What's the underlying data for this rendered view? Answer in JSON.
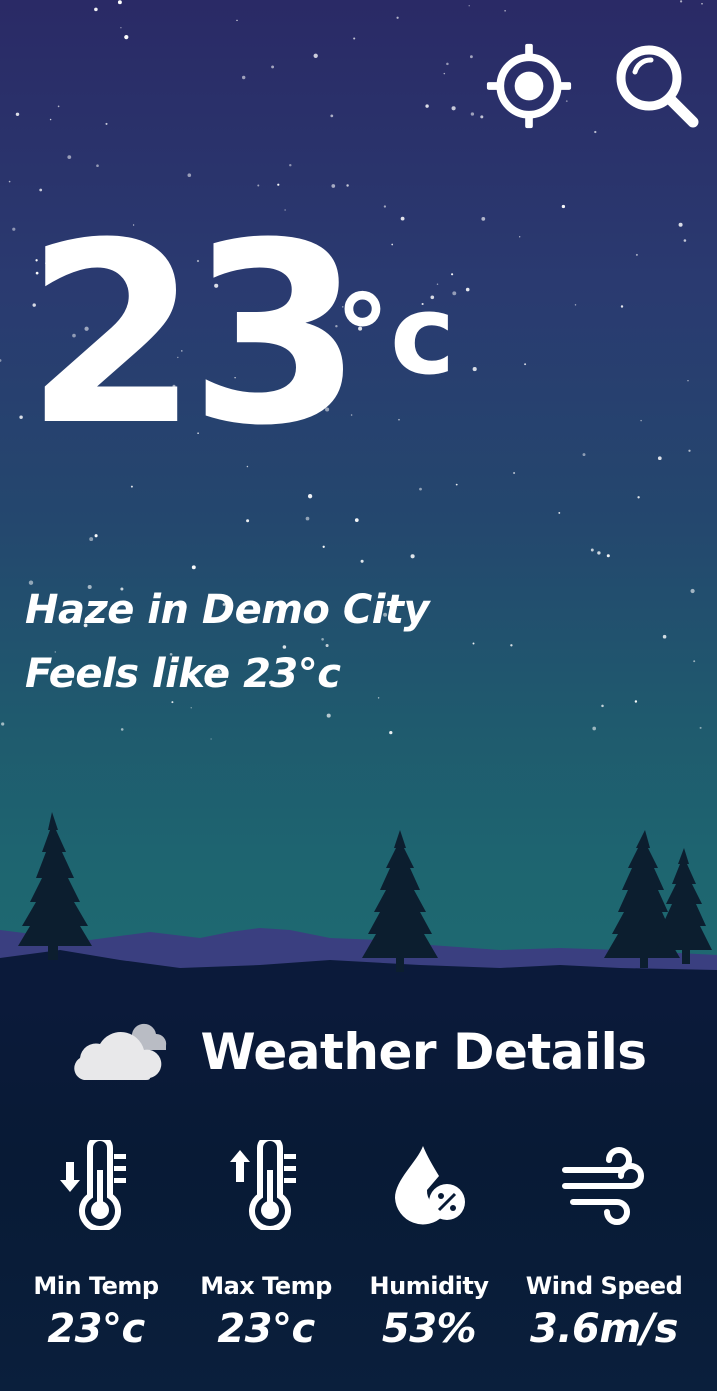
{
  "header": {
    "location_icon": "crosshair-location-icon",
    "search_icon": "search-icon"
  },
  "current": {
    "temperature": "23",
    "unit": "°c",
    "description": "Haze in Demo City",
    "feels_like": "Feels like 23°c"
  },
  "details": {
    "title": "Weather Details",
    "title_icon": "cloud-icon",
    "items": [
      {
        "label": "Min Temp",
        "value": "23°c",
        "icon": "thermometer-down-icon"
      },
      {
        "label": "Max Temp",
        "value": "23°c",
        "icon": "thermometer-up-icon"
      },
      {
        "label": "Humidity",
        "value": "53%",
        "icon": "humidity-drop-icon"
      },
      {
        "label": "Wind Speed",
        "value": "3.6m/s",
        "icon": "wind-icon"
      }
    ]
  },
  "colors": {
    "sky_top": "#2a2a66",
    "sky_bottom": "#1f6a72",
    "ground": "#081a35",
    "mountains": "#3a3f80",
    "trees": "#0c1e2f",
    "text": "#ffffff"
  }
}
